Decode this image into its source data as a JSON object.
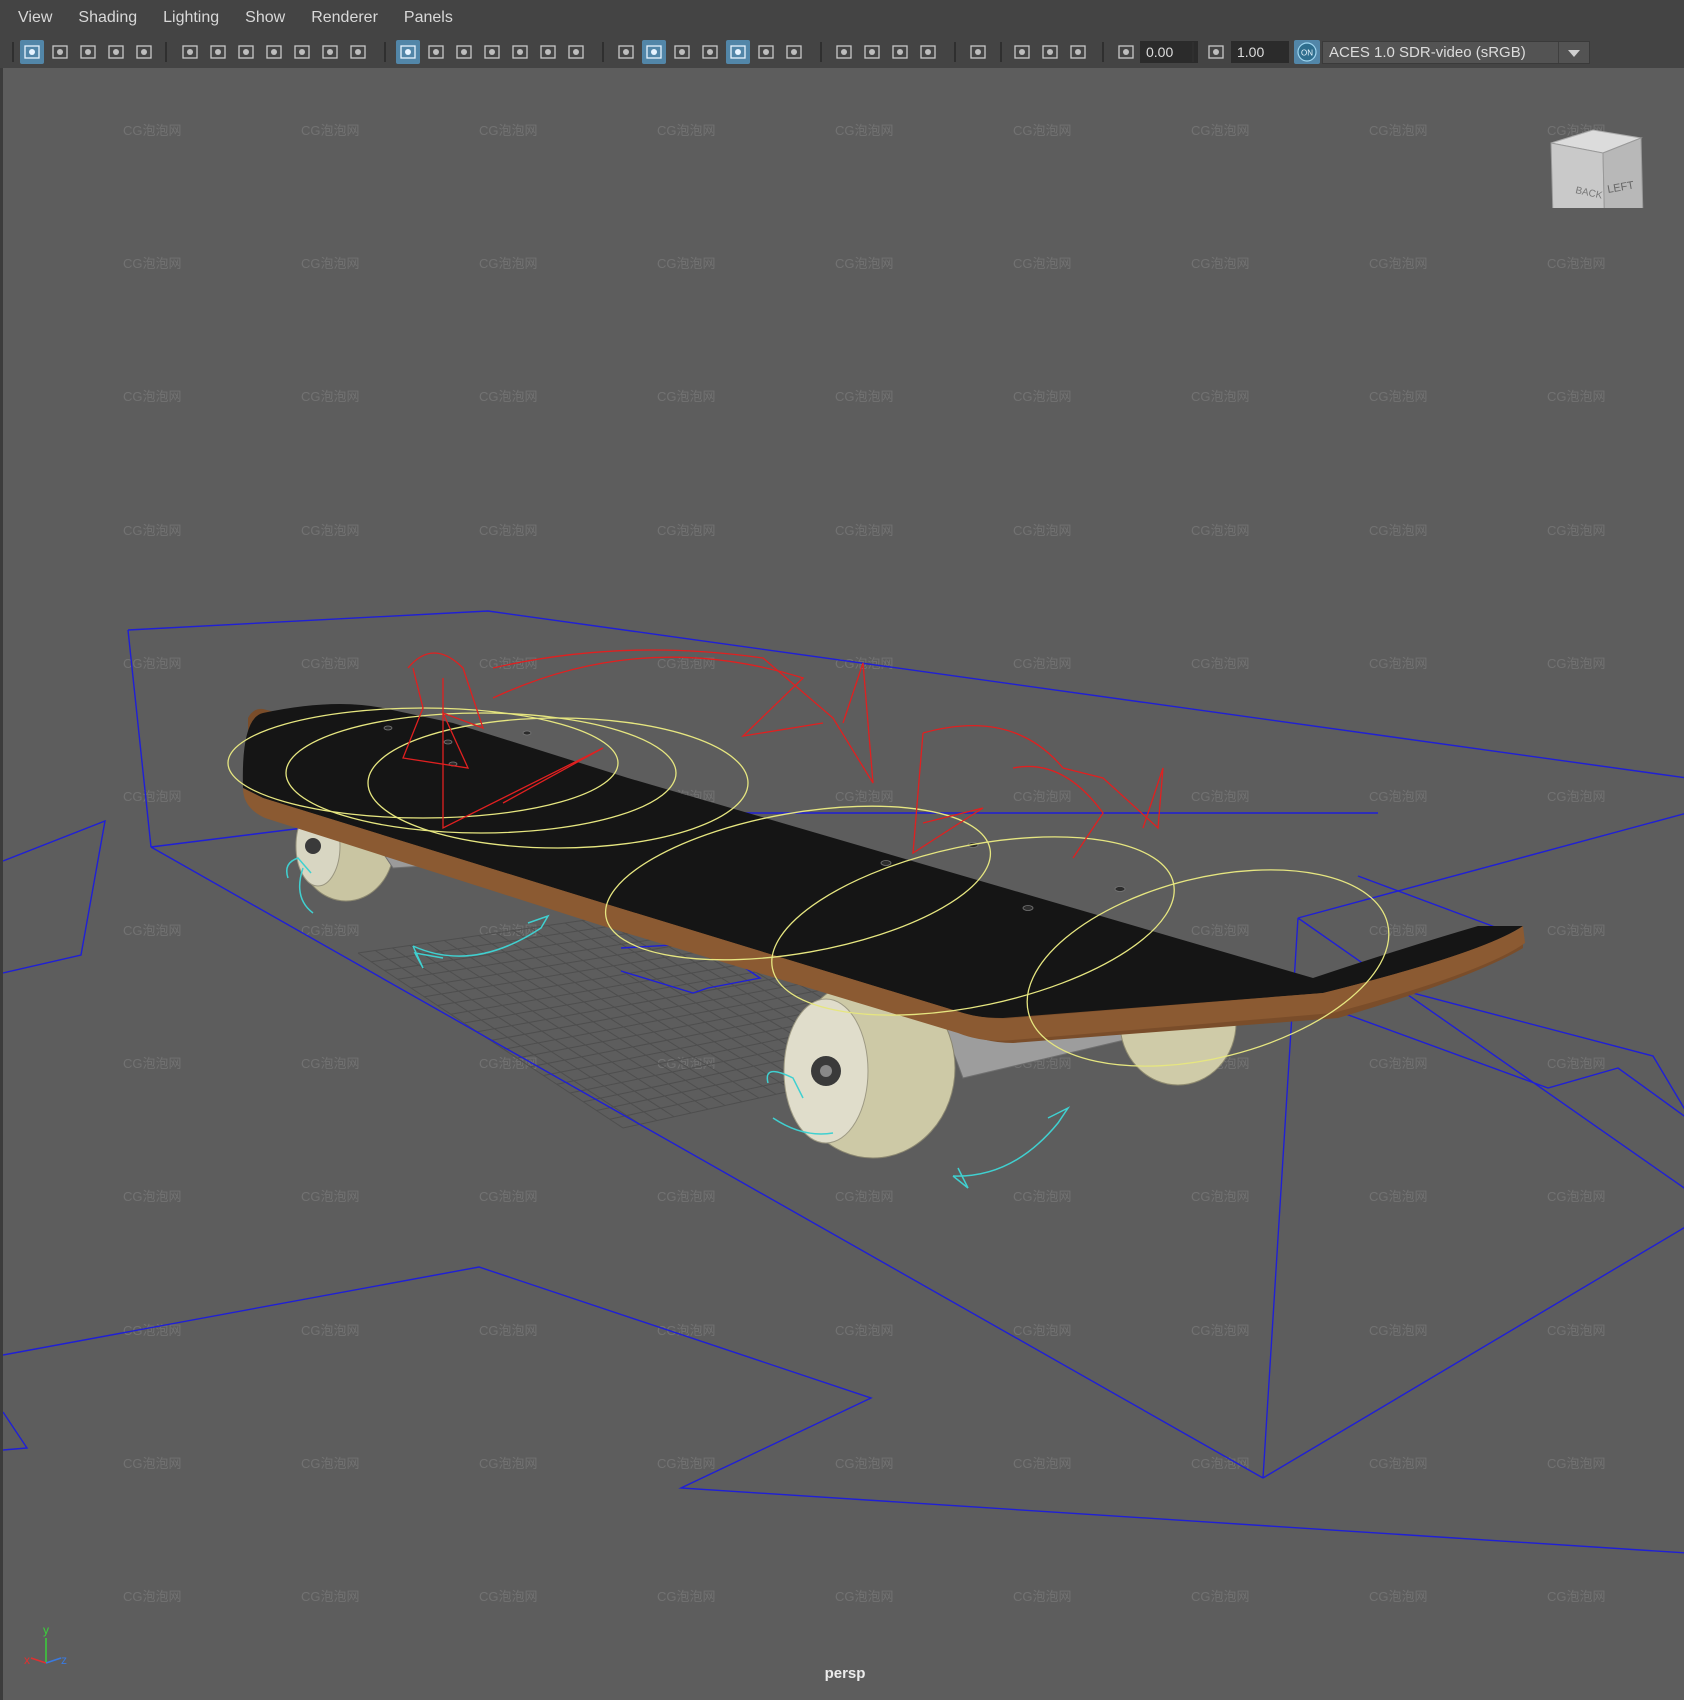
{
  "menu": [
    {
      "label": "View"
    },
    {
      "label": "Shading"
    },
    {
      "label": "Lighting"
    },
    {
      "label": "Show"
    },
    {
      "label": "Renderer"
    },
    {
      "label": "Panels"
    }
  ],
  "toolbar": {
    "exposure_value": "0.00",
    "gamma_value": "1.00",
    "color_management_toggle": "ON",
    "color_space": "ACES 1.0 SDR-video (sRGB)",
    "icons": [
      "select-camera-icon",
      "film-gate-icon",
      "grid-icon",
      "shaded-icon",
      "xray-icon",
      "lighting-icon",
      "shadows-icon",
      "isolate-select-icon",
      "high-quality-icon",
      "exposure-icon",
      "gamma-icon"
    ]
  },
  "viewcube": {
    "back_label": "BACK",
    "left_label": "LEFT"
  },
  "viewport": {
    "camera_name": "persp",
    "watermark": "CG泡泡网"
  },
  "axis_indicator": {
    "x": "x",
    "y": "y",
    "z": "z"
  },
  "colors": {
    "accent": "#5286a8",
    "bounding_box": "#1f1fd6",
    "red_controls": "#e02020",
    "yellow_controls": "#e6e680",
    "cyan_controls": "#40d0d0"
  }
}
